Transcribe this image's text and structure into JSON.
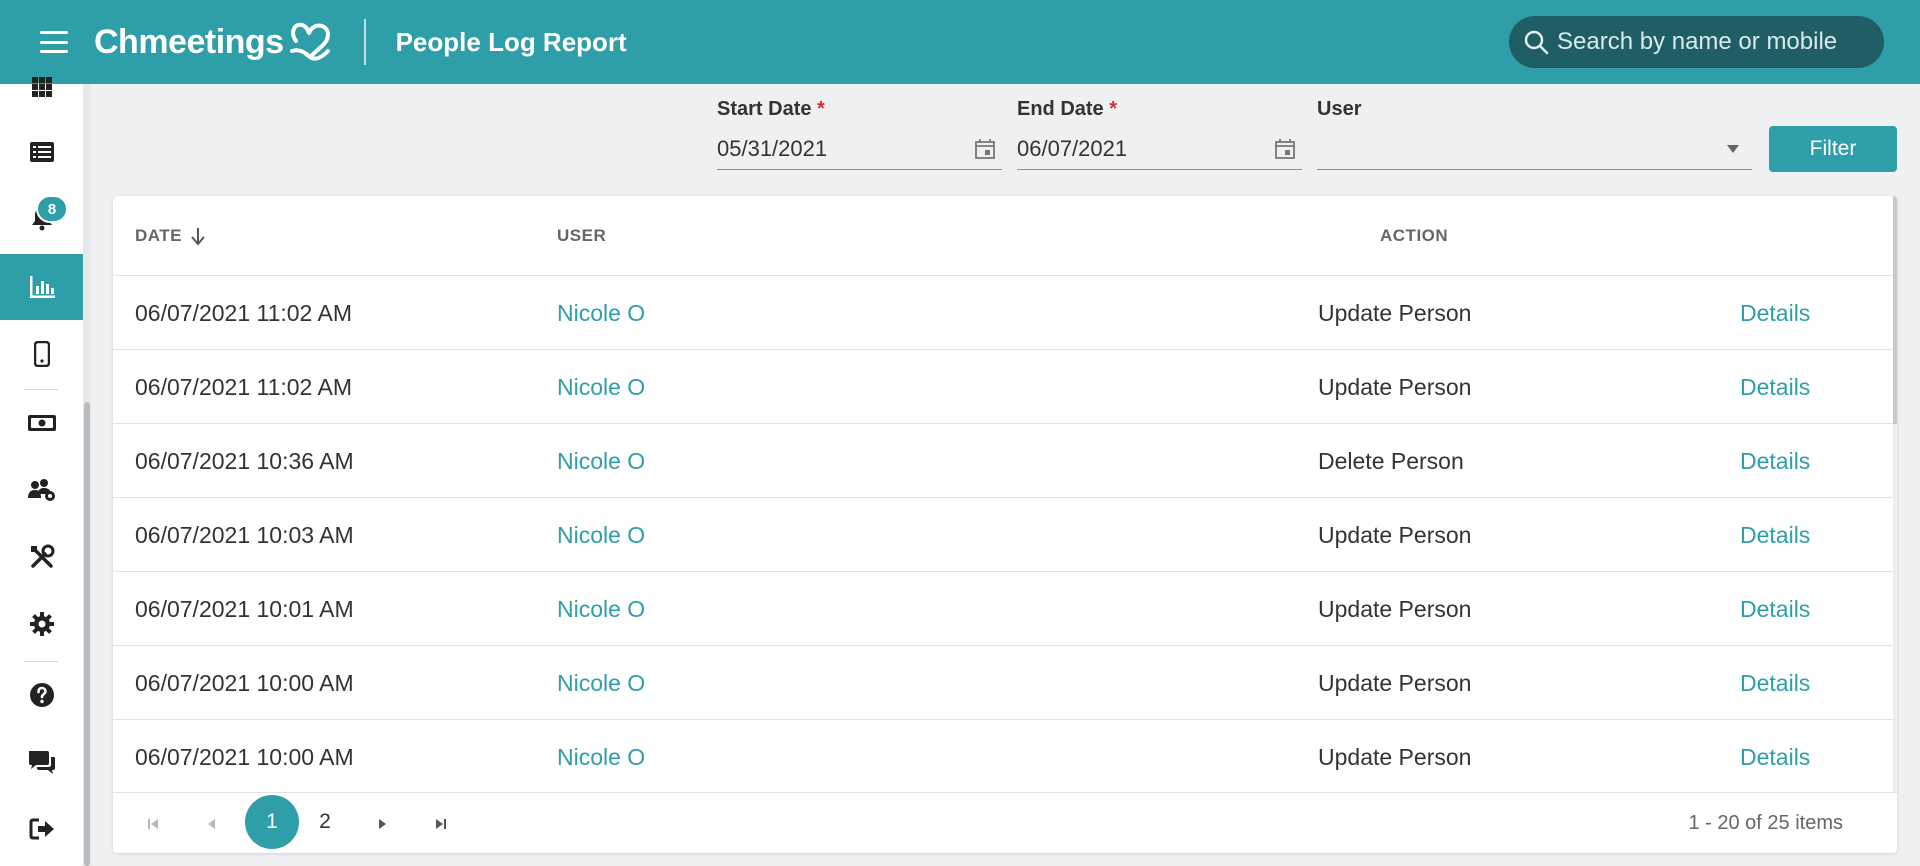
{
  "header": {
    "brand": "Chmeetings",
    "title": "People Log Report",
    "search_placeholder": "Search by name or mobile"
  },
  "sidebar": {
    "notifications_badge": "8",
    "items": [
      {
        "icon": "grid-icon"
      },
      {
        "icon": "list-icon"
      },
      {
        "icon": "bell-icon"
      },
      {
        "icon": "bar-chart-icon",
        "active": true
      },
      {
        "icon": "mobile-icon"
      },
      {
        "icon": "money-icon"
      },
      {
        "icon": "people-gear-icon"
      },
      {
        "icon": "tools-icon"
      },
      {
        "icon": "gear-icon"
      },
      {
        "icon": "help-icon"
      },
      {
        "icon": "chat-icon"
      },
      {
        "icon": "logout-icon"
      }
    ]
  },
  "filters": {
    "start_date_label": "Start Date",
    "start_date_value": "05/31/2021",
    "end_date_label": "End Date",
    "end_date_value": "06/07/2021",
    "required_mark": "*",
    "user_label": "User",
    "user_value": "",
    "filter_button": "Filter"
  },
  "table": {
    "columns": {
      "date": "DATE",
      "user": "USER",
      "action": "ACTION"
    },
    "rows": [
      {
        "date": "06/07/2021 11:02 AM",
        "user": "Nicole O",
        "action": "Update Person",
        "details": "Details"
      },
      {
        "date": "06/07/2021 11:02 AM",
        "user": "Nicole O",
        "action": "Update Person",
        "details": "Details"
      },
      {
        "date": "06/07/2021 10:36 AM",
        "user": "Nicole O",
        "action": "Delete Person",
        "details": "Details"
      },
      {
        "date": "06/07/2021 10:03 AM",
        "user": "Nicole O",
        "action": "Update Person",
        "details": "Details"
      },
      {
        "date": "06/07/2021 10:01 AM",
        "user": "Nicole O",
        "action": "Update Person",
        "details": "Details"
      },
      {
        "date": "06/07/2021 10:00 AM",
        "user": "Nicole O",
        "action": "Update Person",
        "details": "Details"
      },
      {
        "date": "06/07/2021 10:00 AM",
        "user": "Nicole O",
        "action": "Update Person",
        "details": "Details"
      }
    ]
  },
  "pager": {
    "pages": [
      "1",
      "2"
    ],
    "current": "1",
    "info": "1 - 20 of 25 items"
  },
  "colors": {
    "brand": "#2e9ea8",
    "search_bg": "#1f5e64",
    "required": "#d32f2f"
  }
}
